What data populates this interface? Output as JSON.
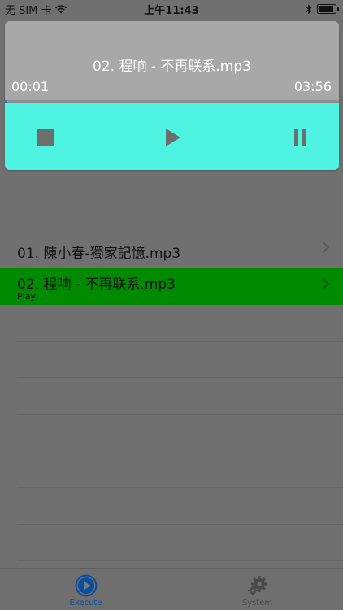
{
  "status_bar": {
    "carrier": "无 SIM 卡",
    "time": "上午11:43",
    "battery_level": 0.9
  },
  "player": {
    "track_title": "02. 程响 - 不再联系.mp3",
    "time_elapsed": "00:01",
    "time_total": "03:56",
    "progress": 0.004,
    "controls": {
      "stop_icon": "stop-icon",
      "play_icon": "play-icon",
      "pause_icon": "pause-icon"
    }
  },
  "playlist": {
    "items": [
      {
        "title": "01. 陳小春-獨家記憶.mp3",
        "subtitle": "",
        "playing": false
      },
      {
        "title": "02. 程响 - 不再联系.mp3",
        "subtitle": "Play",
        "playing": true
      }
    ],
    "playing_color": "#008a00"
  },
  "tab_bar": {
    "tabs": [
      {
        "label": "Execute",
        "icon": "play-circle-icon",
        "active": true,
        "color": "#0a4f9e"
      },
      {
        "label": "System",
        "icon": "gear-icon",
        "active": false,
        "color": "#4a4a4a"
      }
    ]
  },
  "colors": {
    "controls_background": "#4ef3e1",
    "progress": "#2a78c8"
  }
}
